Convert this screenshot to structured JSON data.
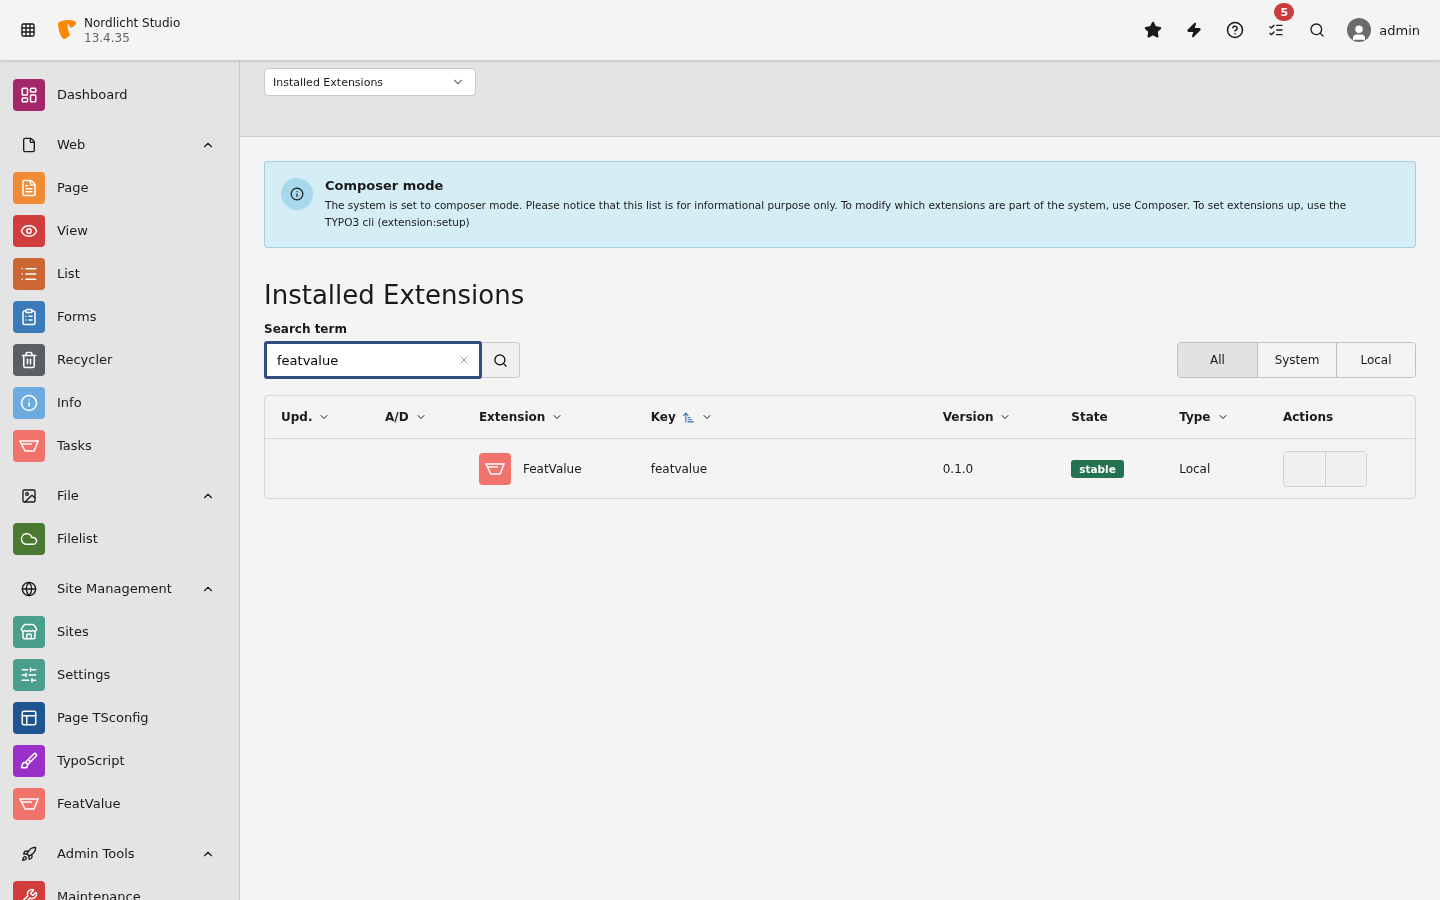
{
  "topbar": {
    "site_name": "Nordlicht Studio",
    "version": "13.4.35",
    "notification_count": "5",
    "username": "admin"
  },
  "sidebar": {
    "items": [
      {
        "kind": "module",
        "label": "Dashboard",
        "color": "#a4276a"
      },
      {
        "kind": "group",
        "label": "Web",
        "expanded": true,
        "children": [
          {
            "kind": "module",
            "label": "Page",
            "color": "#f18b35"
          },
          {
            "kind": "module",
            "label": "View",
            "color": "#d13c3c"
          },
          {
            "kind": "module",
            "label": "List",
            "color": "#cc6633"
          },
          {
            "kind": "module",
            "label": "Forms",
            "color": "#3a7ab8"
          },
          {
            "kind": "module",
            "label": "Recycler",
            "color": "#5a5f63"
          },
          {
            "kind": "module",
            "label": "Info",
            "color": "#6daae0"
          },
          {
            "kind": "module",
            "label": "Tasks",
            "color": "#f2736c"
          }
        ]
      },
      {
        "kind": "group",
        "label": "File",
        "expanded": true,
        "children": [
          {
            "kind": "module",
            "label": "Filelist",
            "color": "#4a7a32"
          }
        ]
      },
      {
        "kind": "group",
        "label": "Site Management",
        "expanded": true,
        "children": [
          {
            "kind": "module",
            "label": "Sites",
            "color": "#4a9e8c"
          },
          {
            "kind": "module",
            "label": "Settings",
            "color": "#4a9e8c"
          },
          {
            "kind": "module",
            "label": "Page TSconfig",
            "color": "#1e5591"
          },
          {
            "kind": "module",
            "label": "TypoScript",
            "color": "#9b2fc9"
          }
        ]
      },
      {
        "kind": "module",
        "label": "FeatValue",
        "color": "#f2736c"
      },
      {
        "kind": "group",
        "label": "Admin Tools",
        "expanded": true,
        "children": [
          {
            "kind": "module",
            "label": "Maintenance",
            "color": "#d13c3c"
          }
        ]
      }
    ]
  },
  "docheader": {
    "select_value": "Installed Extensions"
  },
  "callout": {
    "title": "Composer mode",
    "text": "The system is set to composer mode. Please notice that this list is for informational purpose only. To modify which extensions are part of the system, use Composer. To set extensions up, use the TYPO3 cli (extension:setup)"
  },
  "heading": "Installed Extensions",
  "search": {
    "label": "Search term",
    "value": "featvalue"
  },
  "filters": [
    {
      "label": "All",
      "selected": true
    },
    {
      "label": "System",
      "selected": false
    },
    {
      "label": "Local",
      "selected": false
    }
  ],
  "table": {
    "columns": [
      {
        "label": "Upd.",
        "sortable": true,
        "sorted": false
      },
      {
        "label": "A/D",
        "sortable": true,
        "sorted": false
      },
      {
        "label": "Extension",
        "sortable": true,
        "sorted": false
      },
      {
        "label": "Key",
        "sortable": true,
        "sorted": true
      },
      {
        "label": "Version",
        "sortable": true,
        "sorted": false
      },
      {
        "label": "State",
        "sortable": false
      },
      {
        "label": "Type",
        "sortable": true,
        "sorted": false
      },
      {
        "label": "Actions",
        "sortable": false
      }
    ],
    "rows": [
      {
        "extension": "FeatValue",
        "key": "featvalue",
        "version": "0.1.0",
        "state": "stable",
        "type": "Local"
      }
    ]
  }
}
